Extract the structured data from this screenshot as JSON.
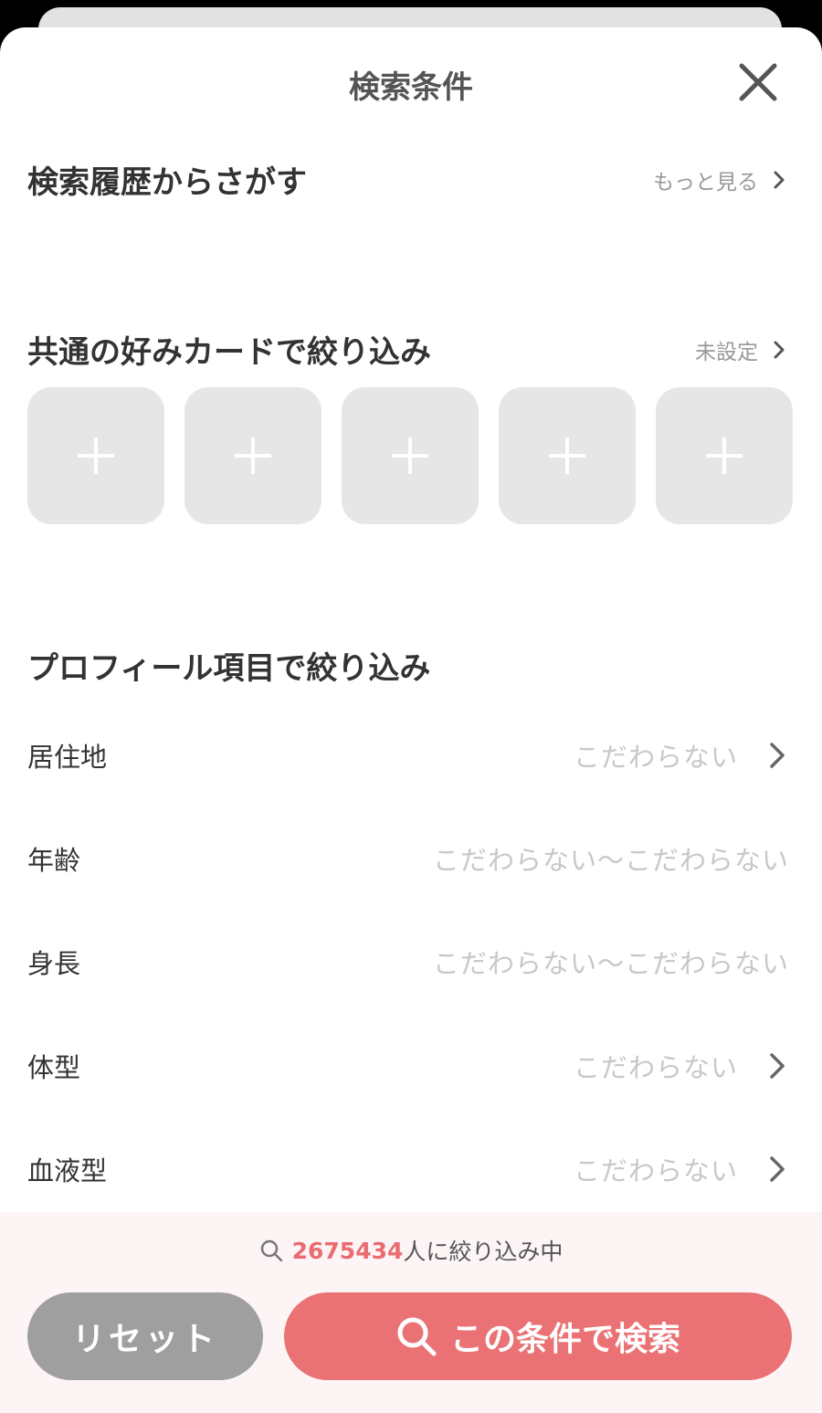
{
  "header": {
    "title": "検索条件"
  },
  "history": {
    "title": "検索履歴からさがす",
    "link": "もっと見る"
  },
  "cards_section": {
    "title": "共通の好みカードで絞り込み",
    "link": "未設定",
    "card_count": 5
  },
  "profile": {
    "title": "プロフィール項目で絞り込み",
    "rows": [
      {
        "label": "居住地",
        "value": "こだわらない",
        "chevron": true
      },
      {
        "label": "年齢",
        "value": "こだわらない～こだわらない",
        "chevron": false
      },
      {
        "label": "身長",
        "value": "こだわらない～こだわらない",
        "chevron": false
      },
      {
        "label": "体型",
        "value": "こだわらない",
        "chevron": true
      },
      {
        "label": "血液型",
        "value": "こだわらない",
        "chevron": true
      }
    ]
  },
  "footer": {
    "count": "2675434",
    "count_suffix": "人に絞り込み中",
    "reset_label": "リセット",
    "search_label": "この条件で検索"
  },
  "colors": {
    "accent": "#ea7275",
    "count_text": "#ea6c70",
    "reset_bg": "#9f9f9f",
    "card_bg": "#e6e6e6",
    "placeholder_text": "#c8c8c8"
  },
  "icons": {
    "close": "close-icon",
    "chevron": "chevron-right-icon",
    "plus": "plus-icon",
    "search": "search-icon"
  }
}
